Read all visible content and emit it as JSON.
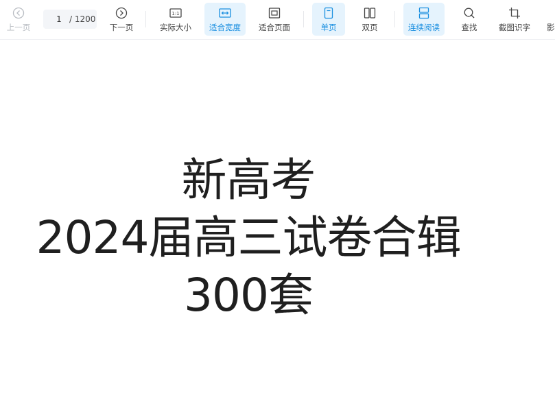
{
  "toolbar": {
    "prev_page": {
      "label": "上一页",
      "icon": "chevron-left-circle-icon"
    },
    "page_input": {
      "value": "1",
      "total": "/ 1200"
    },
    "next_page": {
      "label": "下一页",
      "icon": "chevron-right-circle-icon"
    },
    "actual_size": {
      "label": "实际大小",
      "icon": "one-to-one-icon"
    },
    "fit_width": {
      "label": "适合宽度",
      "icon": "fit-width-icon"
    },
    "fit_page": {
      "label": "适合页面",
      "icon": "fit-page-icon"
    },
    "single_page": {
      "label": "单页",
      "icon": "single-page-icon"
    },
    "double_page": {
      "label": "双页",
      "icon": "double-page-icon"
    },
    "continuous": {
      "label": "连续阅读",
      "icon": "continuous-read-icon"
    },
    "find": {
      "label": "查找",
      "icon": "search-icon"
    },
    "ocr": {
      "label": "截图识字",
      "icon": "crop-icon"
    },
    "more_partial": {
      "label": "影"
    }
  },
  "colors": {
    "accent": "#1a8fe0",
    "active_bg": "#e5f3fd",
    "disabled": "#b8bcc2"
  },
  "document": {
    "line1": "新高考",
    "line2": "2024届高三试卷合辑",
    "line3": "300套"
  }
}
